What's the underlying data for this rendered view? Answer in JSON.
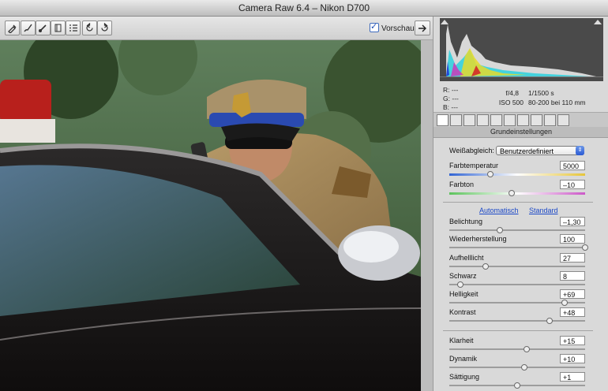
{
  "window": {
    "title": "Camera Raw 6.4 – Nikon D700"
  },
  "toolbar": {
    "tools": [
      "eyedropper-tool-icon",
      "brush-tool-icon",
      "spot-removal-icon",
      "adjustment-brush-icon",
      "graduated-filter-icon",
      "preferences-list-icon",
      "rotate-left-icon",
      "rotate-right-icon"
    ],
    "preview_label": "Vorschau",
    "preview_checked": true
  },
  "readout": {
    "r_label": "R:",
    "g_label": "G:",
    "b_label": "B:",
    "r": "---",
    "g": "---",
    "b": "---"
  },
  "exif": {
    "aperture": "f/4,8",
    "shutter": "1/1500 s",
    "iso": "ISO 500",
    "lens": "80-200 bei 110 mm"
  },
  "panel": {
    "section_title": "Grundeinstellungen",
    "white_balance_label": "Weißabgleich:",
    "white_balance_value": "Benutzerdefiniert",
    "auto_link": "Automatisch",
    "default_link": "Standard",
    "sliders": [
      {
        "label": "Farbtemperatur",
        "value": "5000",
        "level": 0.3
      },
      {
        "label": "Farbton",
        "value": "–10",
        "level": 0.46
      },
      {
        "label": "Belichtung",
        "value": "–1,30",
        "level": 0.37
      },
      {
        "label": "Wiederherstellung",
        "value": "100",
        "level": 1.0
      },
      {
        "label": "Aufhelllicht",
        "value": "27",
        "level": 0.27
      },
      {
        "label": "Schwarz",
        "value": "8",
        "level": 0.08
      },
      {
        "label": "Helligkeit",
        "value": "+69",
        "level": 0.85
      },
      {
        "label": "Kontrast",
        "value": "+48",
        "level": 0.74
      },
      {
        "label": "Klarheit",
        "value": "+15",
        "level": 0.57
      },
      {
        "label": "Dynamik",
        "value": "+10",
        "level": 0.55
      },
      {
        "label": "Sättigung",
        "value": "+1",
        "level": 0.5
      }
    ]
  }
}
